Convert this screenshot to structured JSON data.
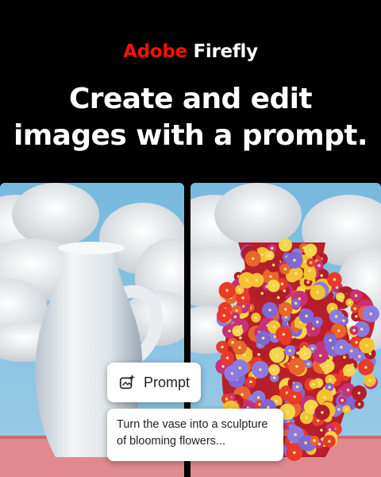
{
  "brand": {
    "name_part1": "Adobe",
    "name_part2": "Firefly",
    "accent": "#fa0f00"
  },
  "headline": {
    "line1": "Create and edit",
    "line2": "images with a prompt."
  },
  "prompt_chip": {
    "label": "Prompt",
    "icon": "sparkle-image-icon"
  },
  "prompt_box": {
    "line1": "Turn the vase into a sculpture",
    "line2": "of blooming flowers..."
  },
  "images": {
    "left": "white-vase-image",
    "right": "flower-vase-image"
  }
}
